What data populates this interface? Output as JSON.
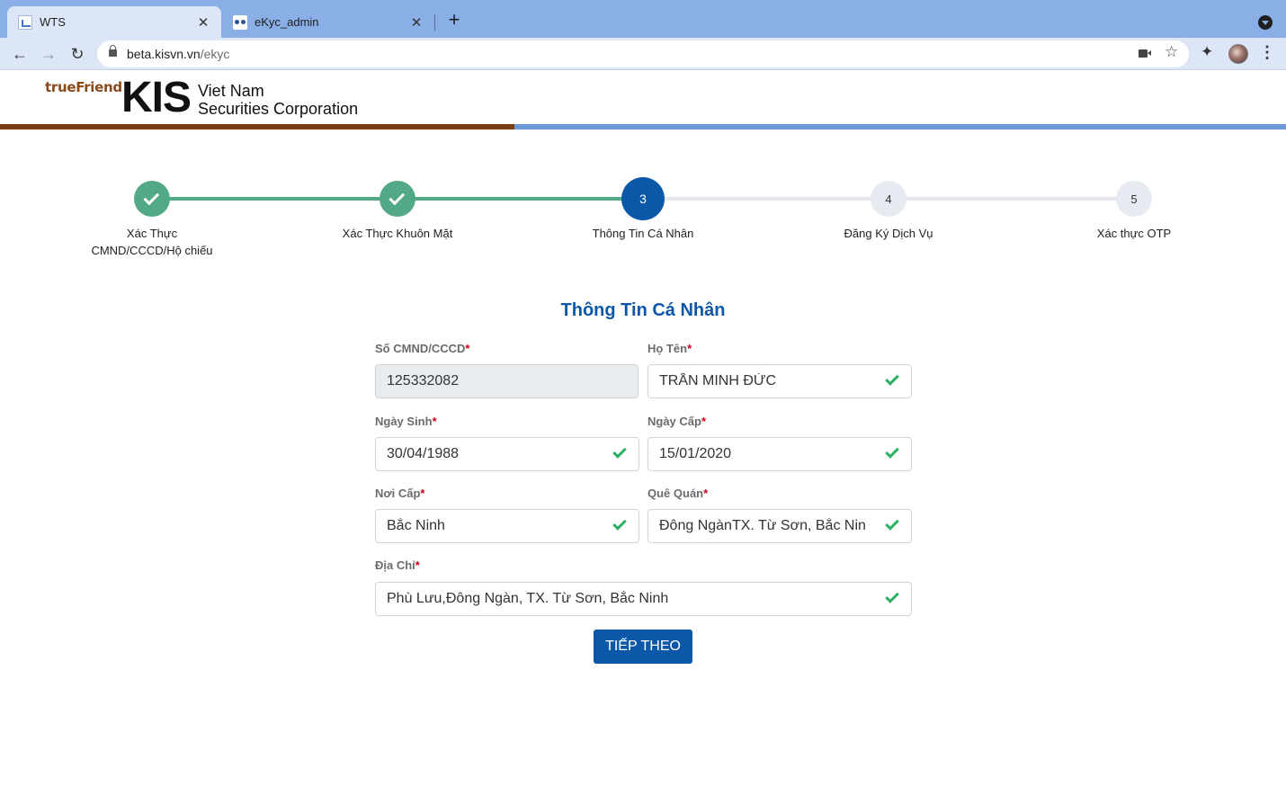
{
  "browser": {
    "tabs": [
      {
        "title": "WTS",
        "favicon": "wts-favicon",
        "active": true
      },
      {
        "title": "eKyc_admin",
        "favicon": "ekyc-favicon",
        "active": false
      }
    ],
    "url_host": "beta.kisvn.vn",
    "url_path": "/ekyc",
    "new_tab_glyph": "+",
    "close_glyph": "✕"
  },
  "header": {
    "tagline": "trueFriend",
    "brand": "KIS",
    "company_line1": "Viet Nam",
    "company_line2": "Securities Corporation",
    "colors": {
      "brown": "#7b3e10",
      "blue": "#6d9ad6"
    }
  },
  "stepper": {
    "steps": [
      {
        "number": "1",
        "label": "Xác Thực\nCMND/CCCD/Hộ chiếu",
        "state": "done"
      },
      {
        "number": "2",
        "label": "Xác Thực Khuôn Mặt",
        "state": "done"
      },
      {
        "number": "3",
        "label": "Thông Tin Cá Nhân",
        "state": "active"
      },
      {
        "number": "4",
        "label": "Đăng Ký Dịch Vụ",
        "state": "todo"
      },
      {
        "number": "5",
        "label": "Xác thực OTP",
        "state": "todo"
      }
    ],
    "colors": {
      "done": "#52a985",
      "active": "#0b58a8",
      "todo": "#e8eaf2"
    }
  },
  "form": {
    "title": "Thông Tin Cá Nhân",
    "required_mark": "*",
    "fields": {
      "id_number": {
        "label": "Số CMND/CCCD",
        "value": "125332082",
        "readonly": true
      },
      "full_name": {
        "label": "Họ Tên",
        "value": "TRẦN MINH ĐỨC",
        "valid": true
      },
      "birth_date": {
        "label": "Ngày Sinh",
        "value": "30/04/1988",
        "valid": true
      },
      "issue_date": {
        "label": "Ngày Cấp",
        "value": "15/01/2020",
        "valid": true
      },
      "issue_place": {
        "label": "Nơi Cấp",
        "value": "Bắc Ninh",
        "valid": true
      },
      "hometown": {
        "label": "Quê Quán",
        "value": "Đông NgànTX. Từ Sơn, Bắc Nin",
        "valid": true
      },
      "address": {
        "label": "Địa Chỉ",
        "value": "Phù Lưu,Đông Ngàn, TX. Từ Sơn, Bắc Ninh",
        "valid": true
      }
    },
    "submit_label": "TIẾP THEO",
    "colors": {
      "accent": "#0b58a8",
      "valid": "#2bb160",
      "required": "#d0021b"
    }
  }
}
